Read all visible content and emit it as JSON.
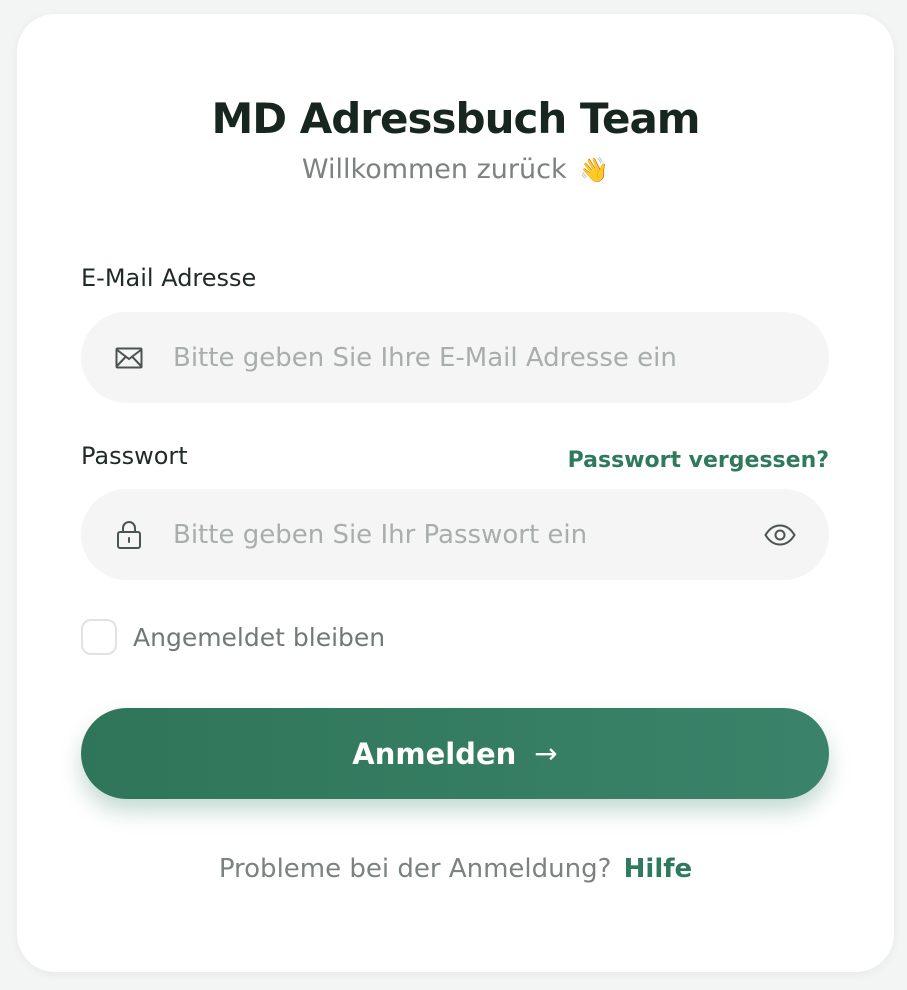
{
  "header": {
    "title": "MD Adressbuch Team",
    "subtitle": "Willkommen zurück",
    "wave_emoji": "👋"
  },
  "email": {
    "label": "E-Mail Adresse",
    "placeholder": "Bitte geben Sie Ihre E-Mail Adresse ein",
    "value": "",
    "icon": "envelope-icon"
  },
  "password": {
    "label": "Passwort",
    "placeholder": "Bitte geben Sie Ihr Passwort ein",
    "value": "",
    "icon": "lock-icon",
    "toggle_icon": "eye-icon",
    "forgot_label": "Passwort vergessen?"
  },
  "remember": {
    "label": "Angemeldet bleiben",
    "checked": false
  },
  "submit": {
    "label": "Anmelden",
    "arrow": "→"
  },
  "footer": {
    "question": "Probleme bei der Anmeldung?",
    "help_label": "Hilfe"
  },
  "colors": {
    "accent": "#2f7a5c",
    "button_start": "#2f7559",
    "button_end": "#3a836a",
    "field_bg": "#f4f5f4",
    "muted_text": "#7b827f"
  }
}
